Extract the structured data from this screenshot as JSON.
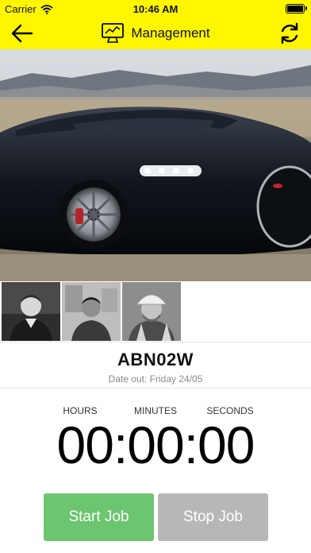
{
  "status_bar": {
    "carrier": "Carrier",
    "time": "10:46 AM"
  },
  "nav": {
    "title": "Management"
  },
  "vehicle": {
    "plate": "ABN02W",
    "date_out": "Date out: Friday 24/05"
  },
  "timer": {
    "labels": {
      "hours": "HOURS",
      "minutes": "MINUTES",
      "seconds": "SECONDS"
    },
    "display": "00:00:00"
  },
  "actions": {
    "start": "Start Job",
    "stop": "Stop Job"
  },
  "colors": {
    "header": "#fff600",
    "start": "#6cc56f",
    "stop": "#b7b7b7"
  }
}
